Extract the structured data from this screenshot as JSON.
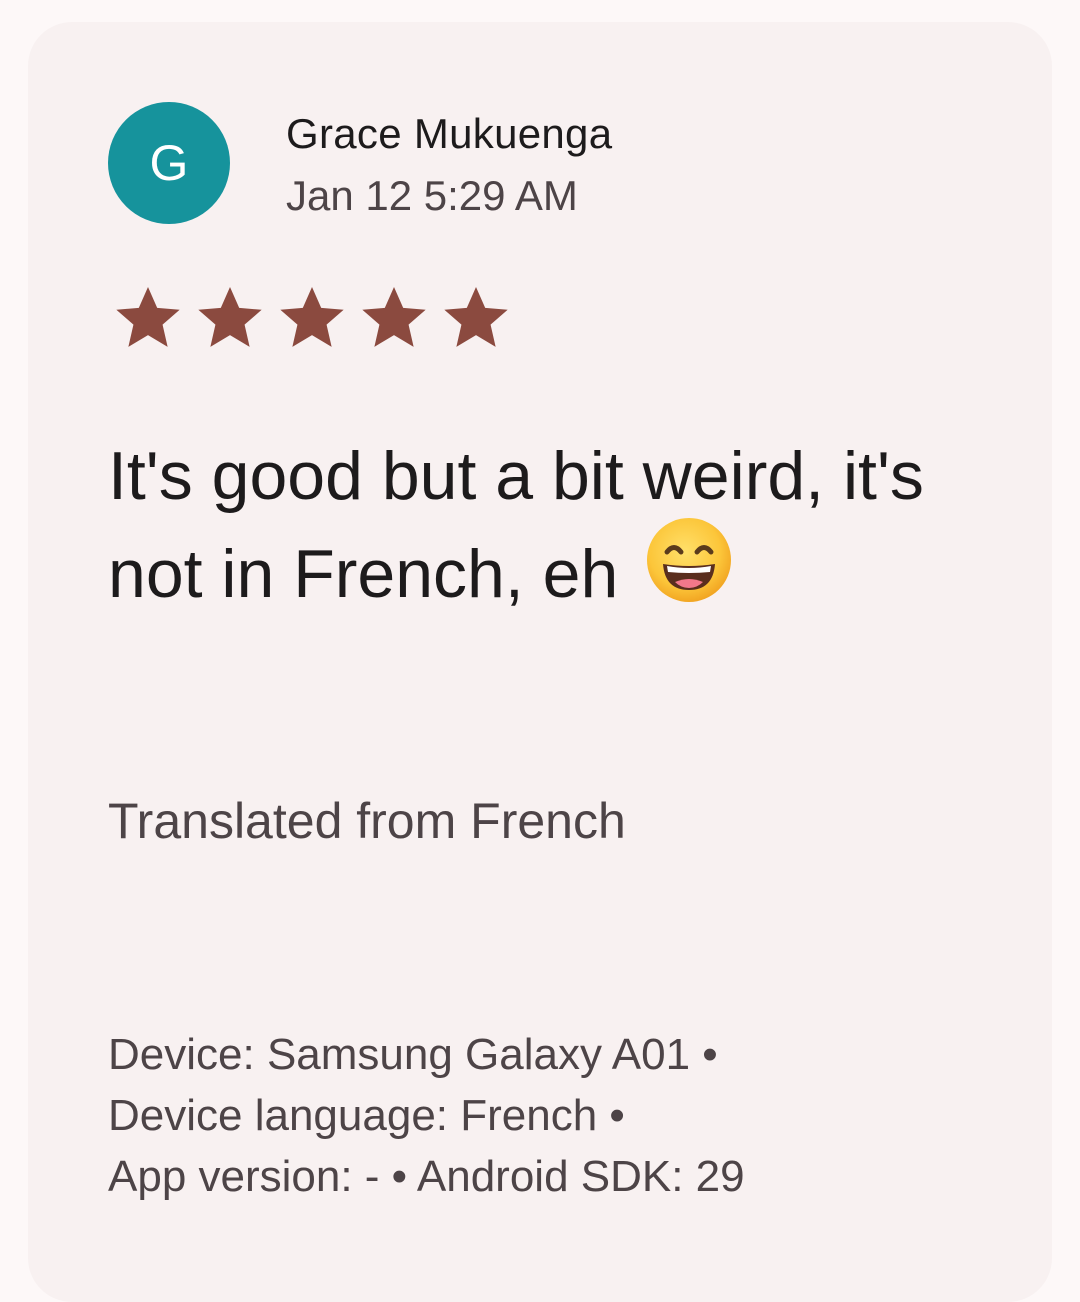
{
  "review": {
    "avatar_letter": "G",
    "avatar_color": "#16939c",
    "author": "Grace Mukuenga",
    "date": "Jan 12 5:29 AM",
    "rating": 5,
    "max_rating": 5,
    "star_color": "#8b4a3f",
    "text": "It's good but a bit weird, it's not in French, eh",
    "emoji_icon": "grinning-face-smiling-eyes-icon",
    "translated_note": "Translated from French",
    "meta": {
      "device": "Device: Samsung Galaxy A01 •",
      "language": "Device language: French •",
      "app": "App version: - • Android SDK: 29"
    }
  }
}
